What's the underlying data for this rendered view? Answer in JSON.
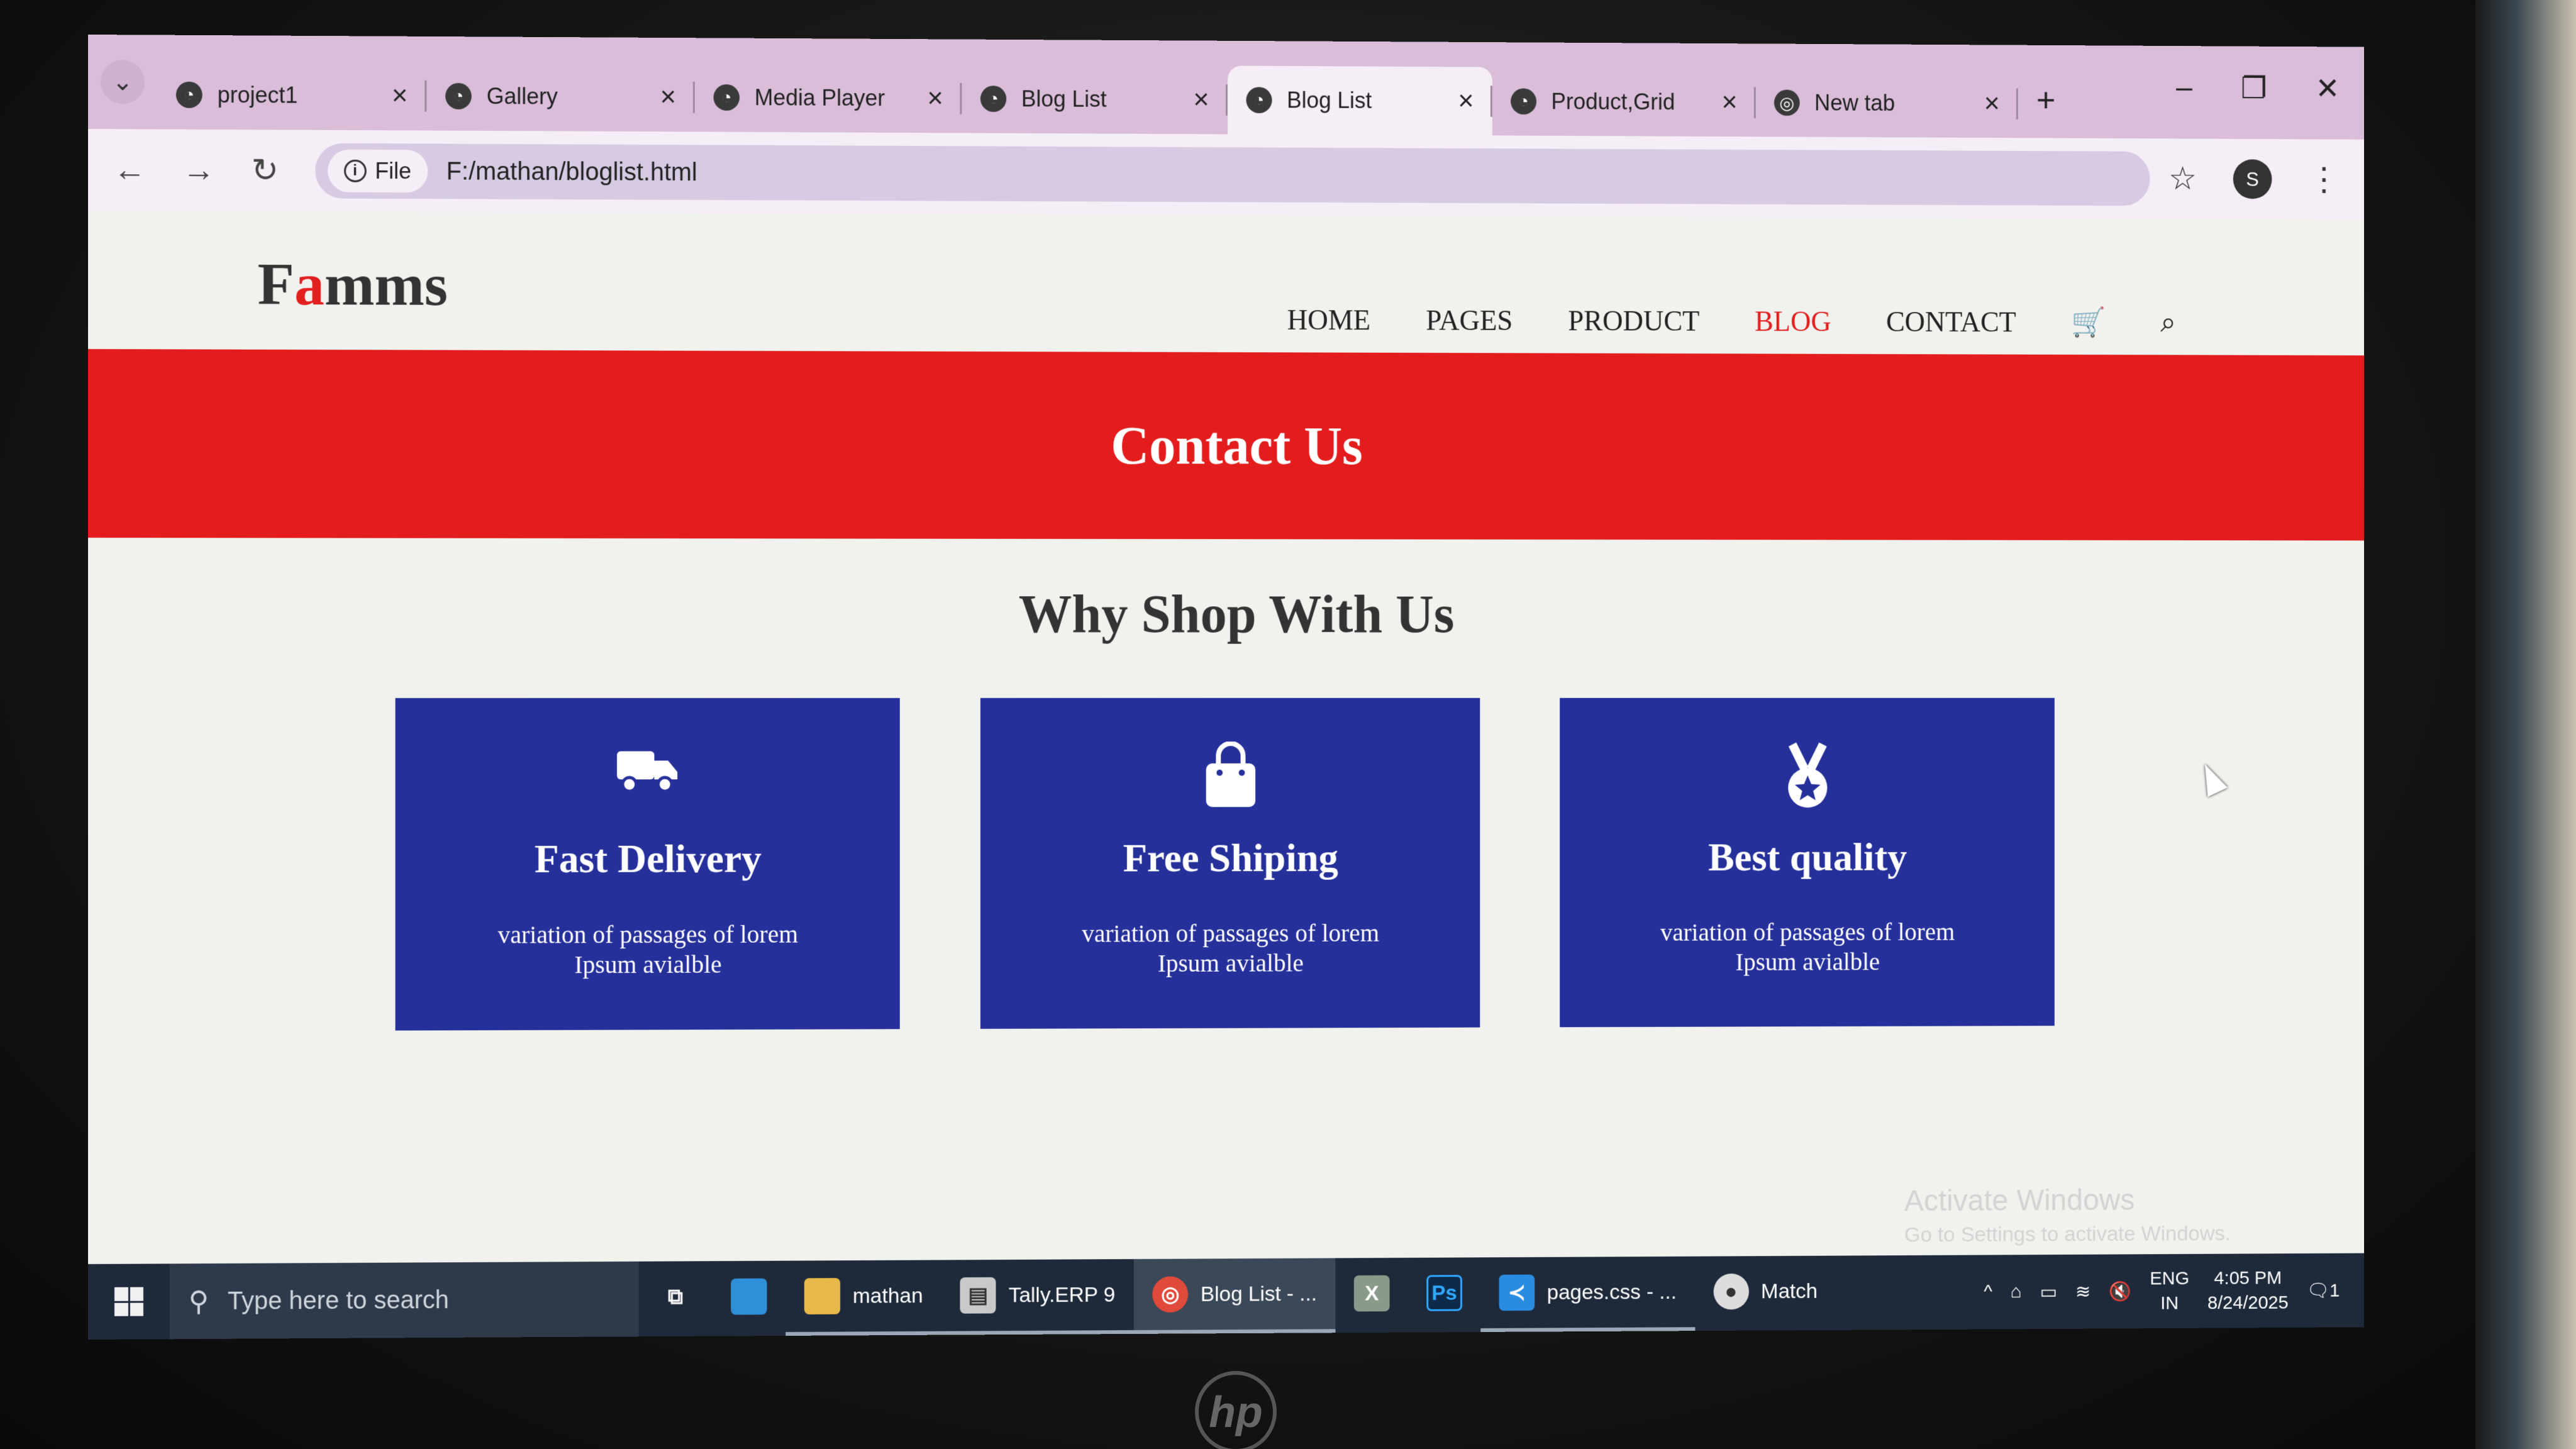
{
  "browser": {
    "tabs": [
      {
        "title": "project1",
        "active": false
      },
      {
        "title": "Gallery",
        "active": false
      },
      {
        "title": "Media Player",
        "active": false
      },
      {
        "title": "Blog List",
        "active": false
      },
      {
        "title": "Blog List",
        "active": true
      },
      {
        "title": "Product,Grid",
        "active": false
      },
      {
        "title": "New tab",
        "active": false
      }
    ],
    "file_label": "File",
    "url": "F:/mathan/bloglist.html",
    "profile_initial": "S"
  },
  "site": {
    "logo_first": "F",
    "logo_accent": "a",
    "logo_rest": "mms",
    "nav": {
      "home": "HOME",
      "pages": "PAGES",
      "product": "PRODUCT",
      "blog": "BLOG",
      "contact": "CONTACT"
    },
    "hero_title": "Contact Us",
    "section_title": "Why Shop With Us",
    "cards": [
      {
        "icon": "truck-icon",
        "title": "Fast Delivery",
        "text": "variation of passages of lorem Ipsum avialble"
      },
      {
        "icon": "shopping-bag-icon",
        "title": "Free Shiping",
        "text": "variation of passages of lorem Ipsum avialble"
      },
      {
        "icon": "medal-icon",
        "title": "Best quality",
        "text": "variation of passages of lorem Ipsum avialble"
      }
    ],
    "colors": {
      "accent": "#e21f1f",
      "card": "#26309a",
      "hero": "#e31d1d"
    }
  },
  "watermark": {
    "title": "Activate Windows",
    "subtitle": "Go to Settings to activate Windows."
  },
  "taskbar": {
    "search_placeholder": "Type here to search",
    "items": [
      {
        "label": "mathan"
      },
      {
        "label": "Tally.ERP 9"
      },
      {
        "label": "Blog List - ..."
      },
      {
        "label": "pages.css - ..."
      },
      {
        "label": "Match"
      }
    ],
    "tray": {
      "lang": "ENG",
      "region": "IN",
      "time": "4:05 PM",
      "date": "8/24/2025",
      "notifications": "1"
    }
  }
}
